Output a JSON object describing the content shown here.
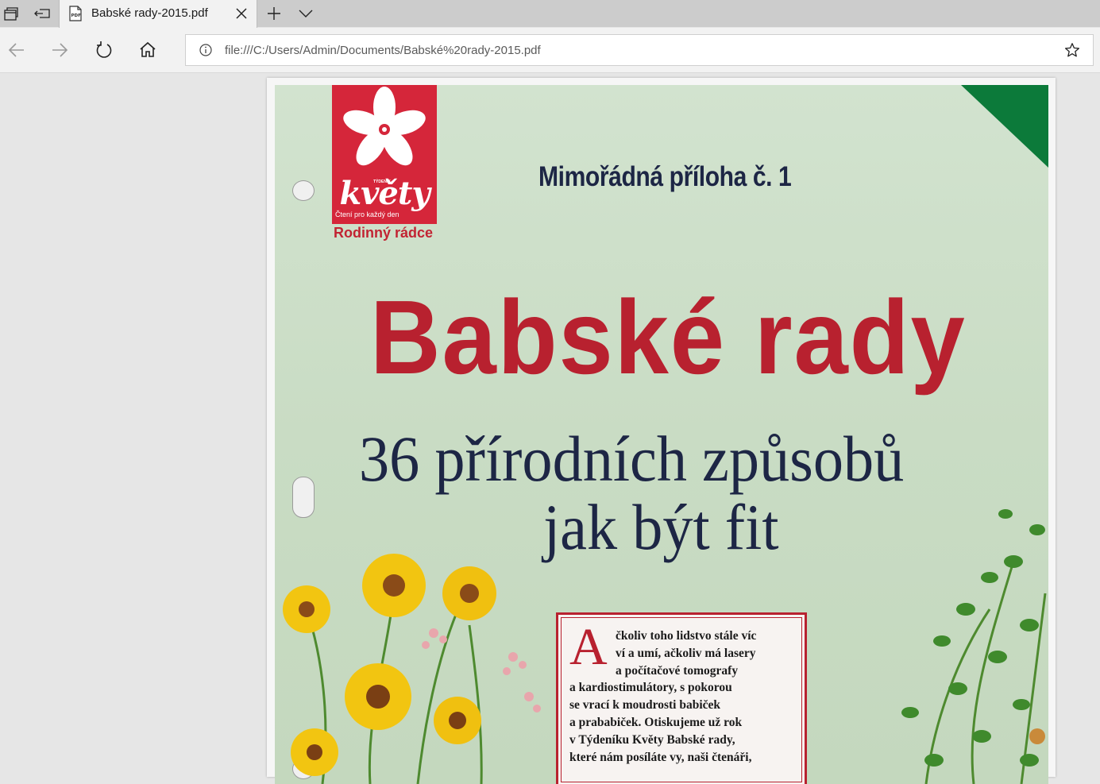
{
  "tab": {
    "title": "Babské rady-2015.pdf"
  },
  "address_bar": {
    "url": "file:///C:/Users/Admin/Documents/Babské%20rady-2015.pdf"
  },
  "icons": {
    "set_aside": "tabs-aside-icon",
    "tabs_restore": "tabs-restore-icon",
    "pdf": "pdf-file-icon",
    "close": "close-icon",
    "new_tab": "plus-icon",
    "tab_list": "chevron-down-icon",
    "back": "back-arrow-icon",
    "forward": "forward-arrow-icon",
    "refresh": "refresh-icon",
    "home": "home-icon",
    "info": "info-icon",
    "favorite": "star-icon"
  },
  "document": {
    "logo": {
      "small_label": "TÝDENÍK",
      "brand": "květy",
      "slogan": "Čtení pro každý den",
      "subbrand": "Rodinný rádce"
    },
    "supplement": "Mimořádná příloha č. 1",
    "title": "Babské rady",
    "subtitle_line1": "36 přírodních způsobů",
    "subtitle_line2": "jak být fit",
    "intro": {
      "drop_cap": "A",
      "lines": [
        "čkoliv toho lidstvo stále víc",
        "ví a umí, ačkoliv má lasery",
        "a počítačové tomografy",
        "a kardiostimulátory, s pokorou",
        "se vrací k moudrosti babiček",
        "a prababiček. Otiskujeme už rok",
        "v Týdeníku Květy Babské rady,",
        "které nám posíláte vy, naši čtenáři,"
      ]
    }
  },
  "colors": {
    "brand_red": "#b8212f",
    "logo_red": "#d5263a",
    "navy_text": "#1d2645",
    "cover_green": "#cfe1cb",
    "corner_green": "#0c7a3a"
  }
}
